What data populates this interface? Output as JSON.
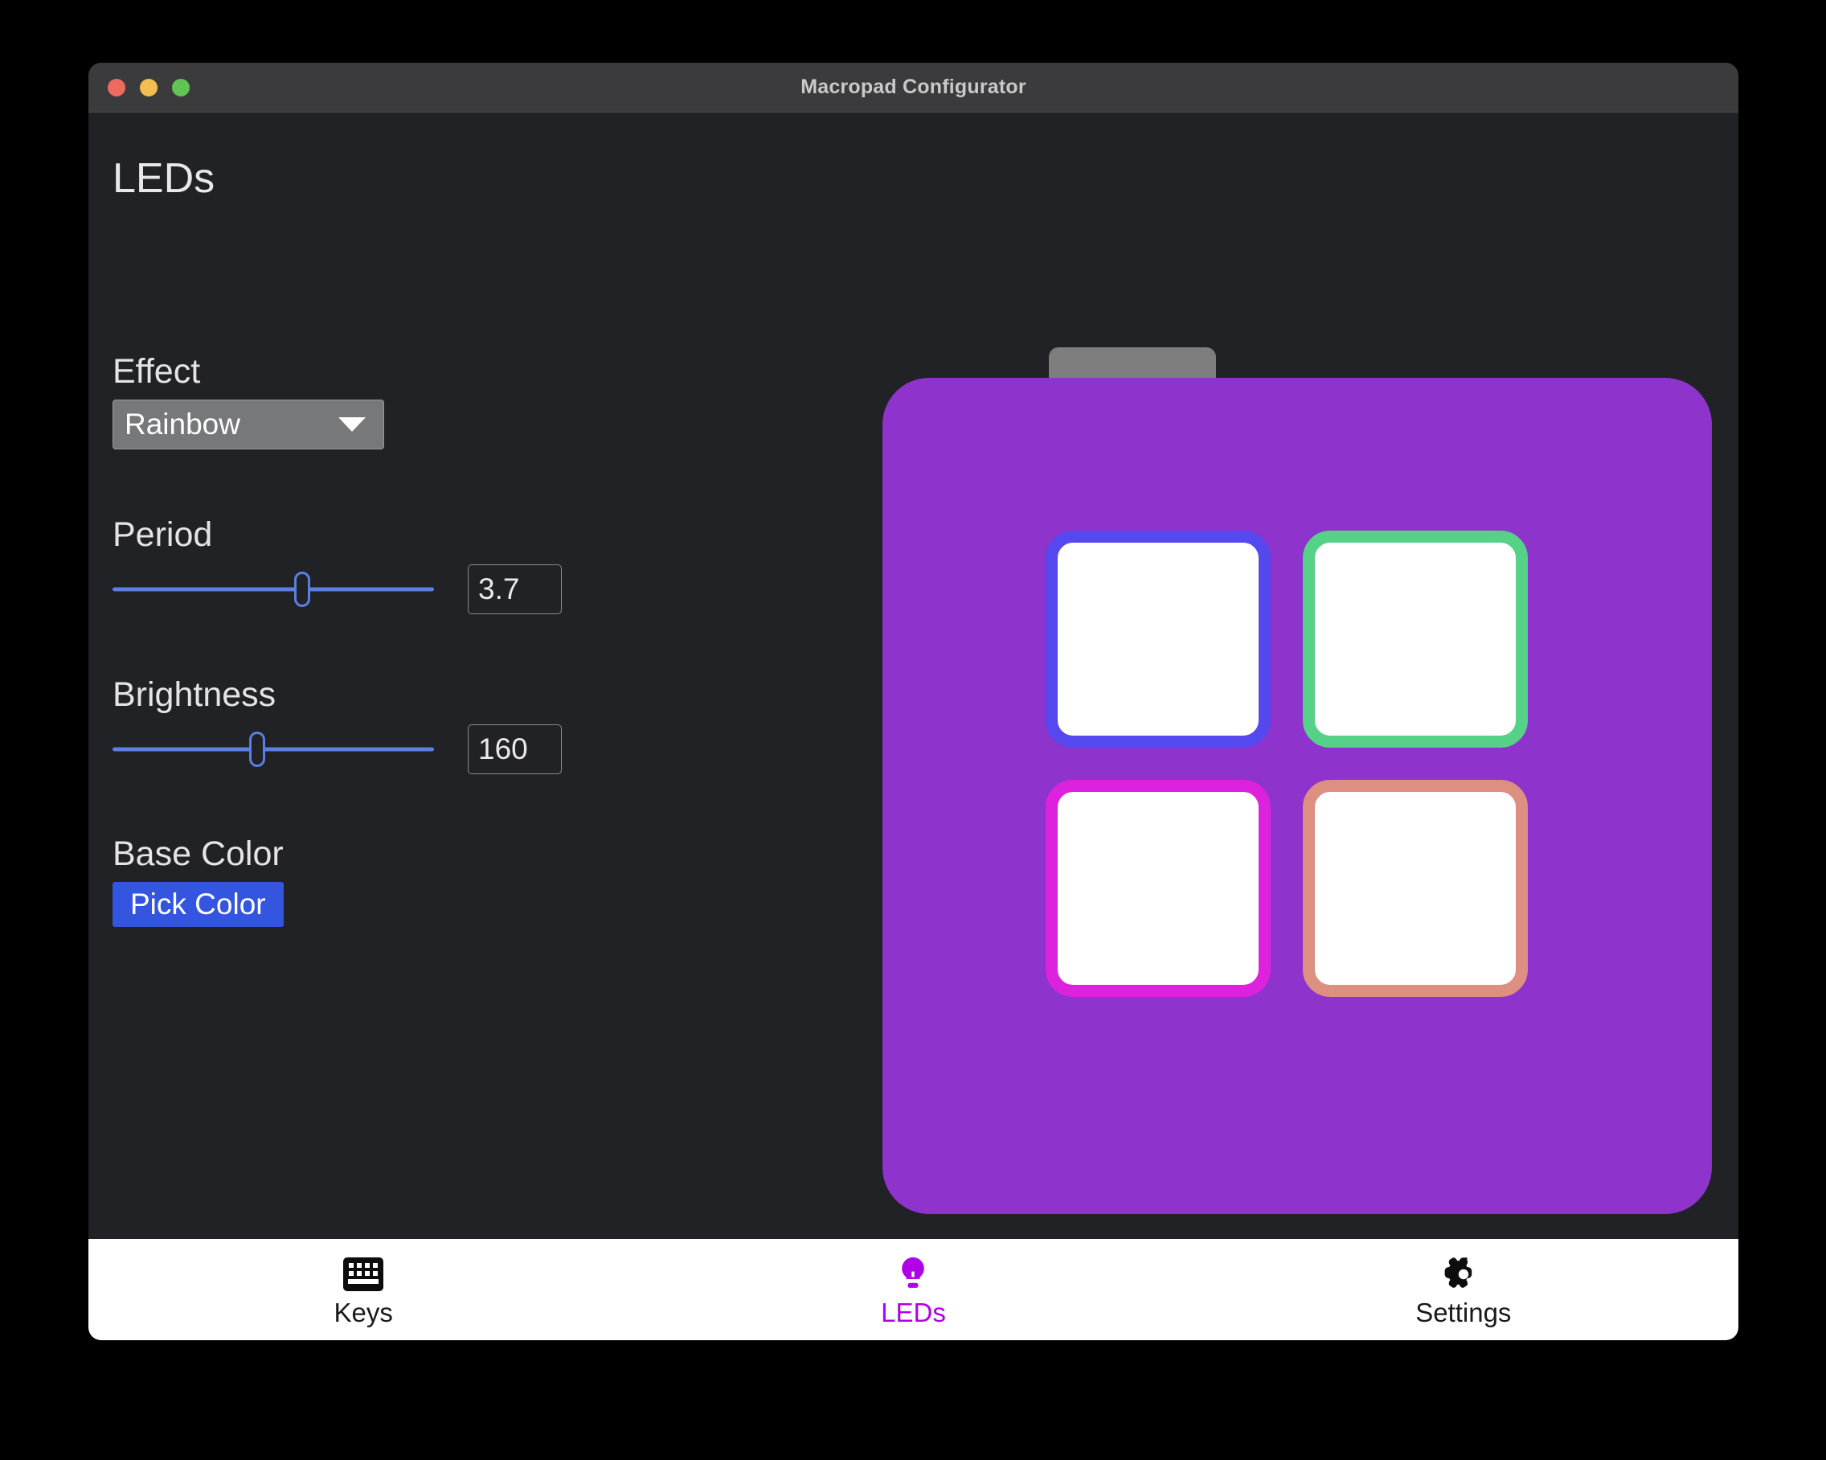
{
  "window": {
    "title": "Macropad Configurator",
    "traffic_lights": [
      "close",
      "minimize",
      "maximize"
    ]
  },
  "page": {
    "title": "LEDs"
  },
  "controls": {
    "effect": {
      "label": "Effect",
      "value": "Rainbow",
      "options": [
        "Rainbow"
      ],
      "icon": "chevron-down-icon"
    },
    "period": {
      "label": "Period",
      "value": "3.7",
      "slider_percent": 59
    },
    "brightness": {
      "label": "Brightness",
      "value": "160",
      "slider_percent": 45
    },
    "base_color": {
      "label": "Base Color",
      "button_label": "Pick Color",
      "button_color": "#3455e0"
    }
  },
  "device_preview": {
    "body_color": "#8e33cb",
    "connector_color": "#7e7e7e",
    "keys": [
      {
        "name": "key-1",
        "color": "#5548ee",
        "face": "#ffffff"
      },
      {
        "name": "key-2",
        "color": "#55d188",
        "face": "#ffffff"
      },
      {
        "name": "key-3",
        "color": "#dd22dd",
        "face": "#ffffff"
      },
      {
        "name": "key-4",
        "color": "#dd8f82",
        "face": "#ffffff"
      }
    ]
  },
  "bottom_nav": {
    "active": "LEDs",
    "active_color": "#b000e8",
    "items": [
      {
        "label": "Keys",
        "icon": "keyboard-icon",
        "active": false
      },
      {
        "label": "LEDs",
        "icon": "lightbulb-icon",
        "active": true
      },
      {
        "label": "Settings",
        "icon": "gear-icon",
        "active": false
      }
    ]
  }
}
